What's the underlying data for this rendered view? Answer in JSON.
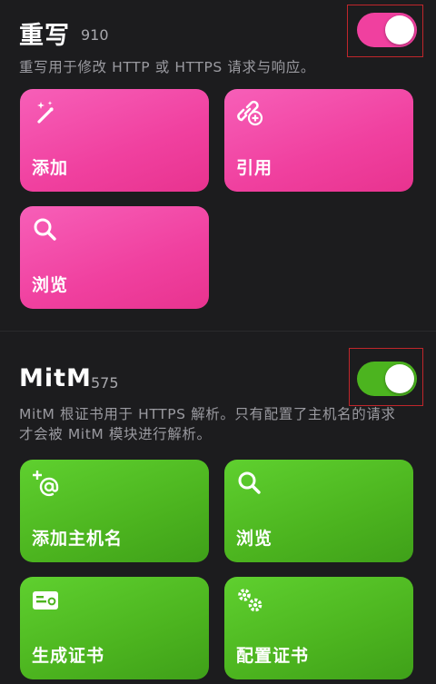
{
  "rewrite": {
    "title": "重写",
    "count": "910",
    "description": "重写用于修改 HTTP 或 HTTPS 请求与响应。",
    "toggle_on": true,
    "accent": "#f0409f",
    "tiles": [
      {
        "label": "添加",
        "icon": "magic-wand-icon"
      },
      {
        "label": "引用",
        "icon": "link-add-icon"
      },
      {
        "label": "浏览",
        "icon": "search-icon"
      }
    ]
  },
  "mitm": {
    "title": "MitM",
    "count": "575",
    "description": "MitM 根证书用于 HTTPS 解析。只有配置了主机名的请求才会被 MitM 模块进行解析。",
    "toggle_on": true,
    "accent": "#4cb41f",
    "tiles": [
      {
        "label": "添加主机名",
        "icon": "add-at-icon"
      },
      {
        "label": "浏览",
        "icon": "search-icon"
      },
      {
        "label": "生成证书",
        "icon": "certificate-icon"
      },
      {
        "label": "配置证书",
        "icon": "gears-icon"
      }
    ]
  }
}
